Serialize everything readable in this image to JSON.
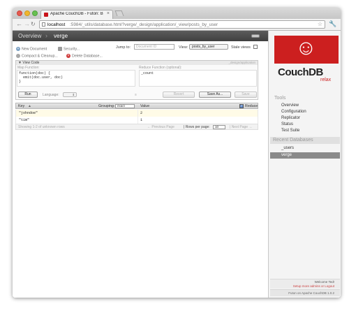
{
  "browser": {
    "tab_title": "Apache CouchDB - Futon: B",
    "tab_close": "×",
    "url_host": "localhost",
    "url_path": ":5984/_utils/database.html?verge/_design/application/_view/posts_by_user",
    "nav_back": "←",
    "nav_forward": "→",
    "nav_reload": "↻",
    "star": "☆",
    "wrench": "🔧"
  },
  "breadcrumb": {
    "overview": "Overview",
    "separator": "›",
    "database": "verge"
  },
  "actions": {
    "new_document": "New Document",
    "security": "Security...",
    "compact": "Compact & Cleanup...",
    "delete_database": "Delete Database...",
    "plus_glyph": "+",
    "delete_glyph": "×"
  },
  "controls": {
    "jump_label": "Jump to:",
    "jump_placeholder": "Document ID",
    "view_label": "View:",
    "view_selected": "posts_by_user",
    "stale_label": "Stale views"
  },
  "code_panel": {
    "title": "▼ View Code",
    "design_doc": "_design/application",
    "map_label": "Map Function:",
    "reduce_label": "Reduce Function (optional):",
    "map_code": "function(doc) {\n  emit(doc.user, doc)\n}",
    "reduce_code": "_count",
    "run": "Run",
    "language_label": "Language:",
    "language_value": "⇕",
    "splitter": "≡",
    "revert": "Revert",
    "save_as": "Save As...",
    "save": "Save"
  },
  "grid": {
    "key_header": "Key",
    "sort_glyph": "▲",
    "grouping_label": "Grouping:",
    "grouping_value": "exact",
    "value_header": "Value",
    "reduce_check": "✓",
    "reduce_label": "Reduce",
    "rows": [
      {
        "key": "\"johndoe\"",
        "value": "2"
      },
      {
        "key": "\"tim\"",
        "value": "1"
      }
    ],
    "showing": "Showing 1-2 of unknown rows",
    "prev": "← Previous Page",
    "rows_per_page_label": "| Rows per page:",
    "rows_per_page": "10",
    "next": "| Next Page →"
  },
  "sidebar": {
    "logo_text": "CouchDB",
    "logo_tagline": "relax",
    "tools_heading": "Tools",
    "tools": [
      "Overview",
      "Configuration",
      "Replicator",
      "Status",
      "Test Suite"
    ],
    "recent_heading": "Recent Databases",
    "recent": [
      "_users",
      "verge"
    ],
    "welcome": "Welcome Ted!",
    "admin_note": "Setup more admins or Logout",
    "version": "Futon on Apache CouchDB 1.0.2"
  },
  "colors": {
    "brand_red": "#cc1f1f",
    "topbar": "#4a4a4a",
    "odd_row": "#fffbe7",
    "selected_db": "#8a8a8a"
  }
}
